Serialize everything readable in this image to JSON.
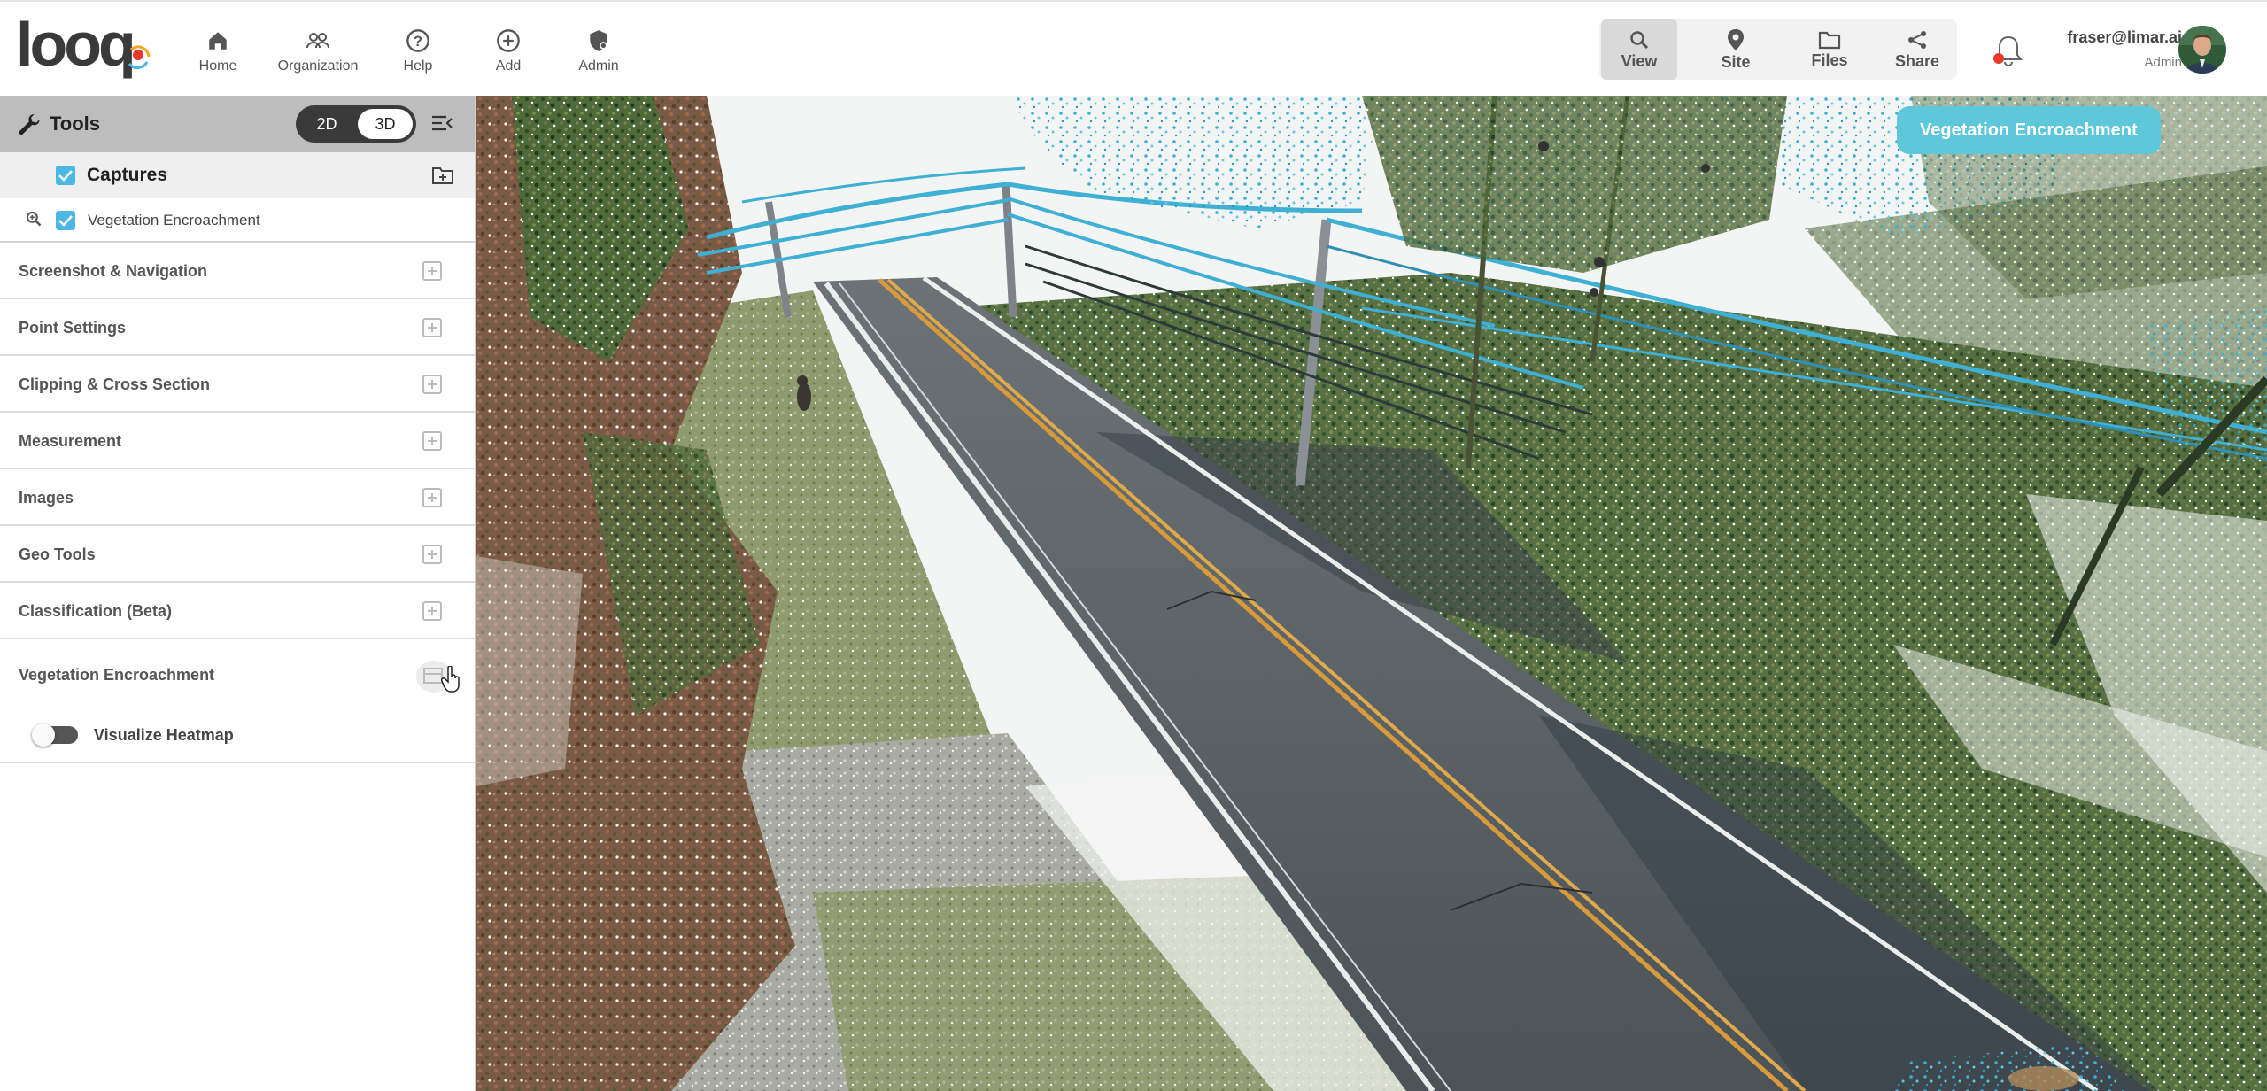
{
  "app": {
    "logo_text": "looq",
    "brand_color": "#e8392b",
    "accent_color": "#5ec7da"
  },
  "nav": {
    "items": [
      {
        "label": "Home",
        "icon": "home-icon"
      },
      {
        "label": "Organization",
        "icon": "organization-icon"
      },
      {
        "label": "Help",
        "icon": "help-icon"
      },
      {
        "label": "Add",
        "icon": "add-icon"
      },
      {
        "label": "Admin",
        "icon": "admin-icon"
      }
    ],
    "view_group": [
      {
        "label": "View",
        "icon": "search-icon",
        "active": true
      },
      {
        "label": "Site",
        "icon": "location-pin-icon",
        "active": false
      },
      {
        "label": "Files",
        "icon": "folder-icon",
        "active": false
      },
      {
        "label": "Share",
        "icon": "share-icon",
        "active": false
      }
    ],
    "user": {
      "email": "fraser@limar.ai",
      "role": "Admin"
    }
  },
  "sidebar": {
    "title": "Tools",
    "mode_toggle": {
      "options": [
        "2D",
        "3D"
      ],
      "selected": "3D"
    },
    "captures": {
      "label": "Captures",
      "checked": true
    },
    "layers": [
      {
        "label": "Vegetation Encroachment",
        "checked": true
      }
    ],
    "sections": [
      {
        "label": "Screenshot & Navigation"
      },
      {
        "label": "Point Settings"
      },
      {
        "label": "Clipping & Cross Section"
      },
      {
        "label": "Measurement"
      },
      {
        "label": "Images"
      },
      {
        "label": "Geo Tools"
      },
      {
        "label": "Classification (Beta)"
      }
    ],
    "vegetation": {
      "label": "Vegetation Encroachment",
      "heatmap_label": "Visualize Heatmap",
      "heatmap_on": false
    }
  },
  "viewport": {
    "badge": "Vegetation Encroachment"
  }
}
